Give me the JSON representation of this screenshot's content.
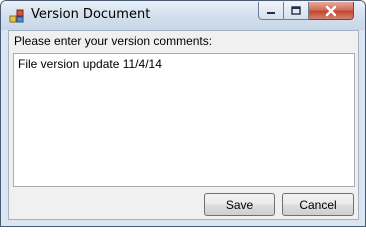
{
  "window": {
    "title": "Version Document",
    "app_icon": "version-app-icon",
    "controls": {
      "minimize_icon": "minimize-icon",
      "maximize_icon": "maximize-icon",
      "close_icon": "close-icon"
    }
  },
  "form": {
    "prompt_label": "Please enter your version comments:",
    "comments_value": "File version update 11/4/14"
  },
  "buttons": {
    "save_label": "Save",
    "cancel_label": "Cancel"
  },
  "colors": {
    "close_button": "#c3472f",
    "titlebar": "#d5e1ee",
    "client_background": "#f0f0f0"
  }
}
